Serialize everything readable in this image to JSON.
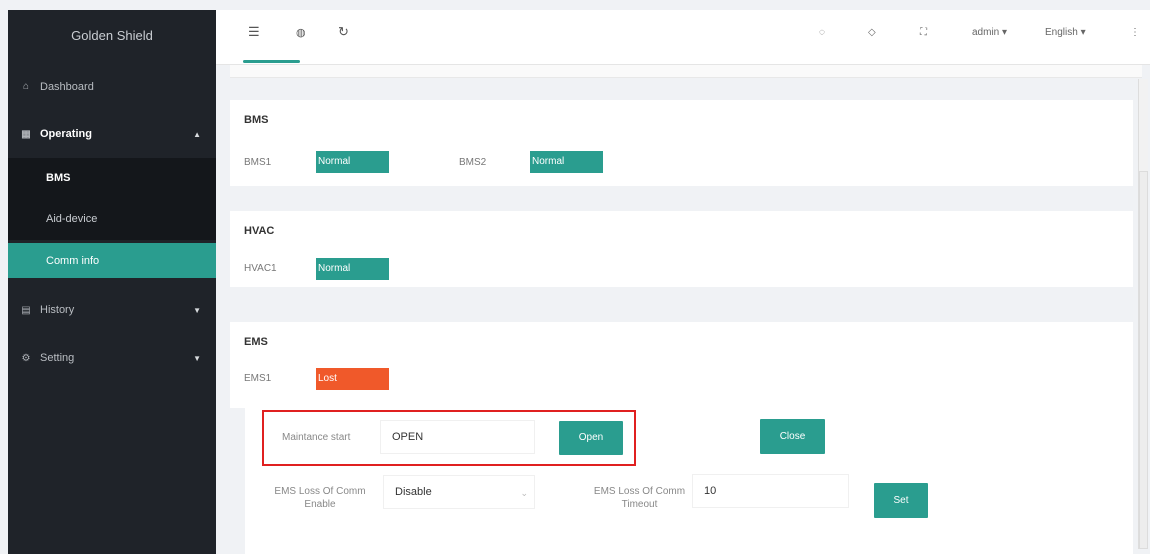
{
  "app": {
    "title": "Golden Shield"
  },
  "sidebar": {
    "dashboard": "Dashboard",
    "operating": "Operating",
    "sub_items": [
      "BMS",
      "Aid-device",
      "Comm info"
    ],
    "history": "History",
    "setting": "Setting"
  },
  "topbar": {
    "user": "admin",
    "language": "English"
  },
  "bms": {
    "title": "BMS",
    "items": [
      {
        "label": "BMS1",
        "status": "Normal"
      },
      {
        "label": "BMS2",
        "status": "Normal"
      }
    ]
  },
  "hvac": {
    "title": "HVAC",
    "items": [
      {
        "label": "HVAC1",
        "status": "Normal"
      }
    ]
  },
  "ems": {
    "title": "EMS",
    "items": [
      {
        "label": "EMS1",
        "status": "Lost"
      }
    ]
  },
  "controls": {
    "maintenance_label": "Maintance start",
    "maintenance_value": "OPEN",
    "open_button": "Open",
    "close_button": "Close",
    "loss_enable_label": "EMS Loss Of Comm Enable",
    "loss_enable_value": "Disable",
    "loss_timeout_label": "EMS Loss Of Comm Timeout",
    "loss_timeout_value": "10",
    "set_button": "Set"
  },
  "colors": {
    "accent": "#2a9d8f",
    "lost": "#f0592a",
    "sidebar_bg": "#1f2329",
    "highlight": "#e02020"
  }
}
